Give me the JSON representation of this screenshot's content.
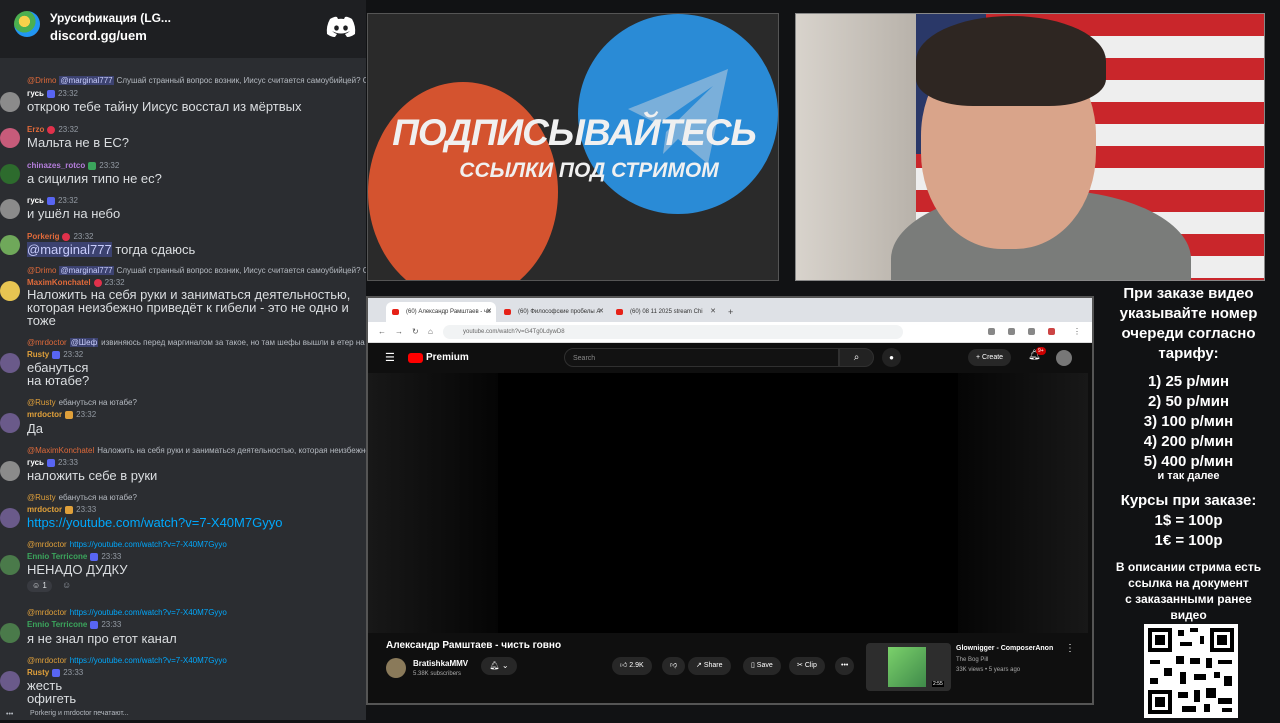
{
  "chat": {
    "server_name": "Урусификация (LG...",
    "server_invite": "discord.gg/uem",
    "typing": "Porkerig и mrdoctor печатают...",
    "messages": [
      {
        "reply_name": "@Drimo",
        "reply_mention": "@marginal777",
        "reply_text": "Слушай странный вопрос возник, Иисус считается самоубийцей?  Он вед",
        "user": "гусь",
        "user_color": "#ffffff",
        "time": "23:32",
        "text": "открою тебе тайну Иисус восстал из мёртвых"
      },
      {
        "user": "Erzo",
        "user_color": "#e06a3a",
        "time": "23:32",
        "text": "Мальта не в ЕС?"
      },
      {
        "user": "chinazes_rotco",
        "user_color": "#b57edc",
        "time": "23:32",
        "text": "а сицилия типо не ес?"
      },
      {
        "user": "гусь",
        "user_color": "#ffffff",
        "time": "23:32",
        "text": "и ушёл на небо"
      },
      {
        "user": "Porkerig",
        "user_color": "#e06a3a",
        "time": "23:32",
        "text_mention": "@marginal777",
        "text": " тогда сдаюсь"
      },
      {
        "reply_name": "@Drimo",
        "reply_mention": "@marginal777",
        "reply_text": "Слушай странный вопрос возник, Иисус считается самоубийцей?  Он вед",
        "user": "MaximKonchatel",
        "user_color": "#e06a3a",
        "time": "23:32",
        "text": "Наложить на себя руки и заниматься деятельностью, которая неизбежно приведёт  к гибели - это не одно и тоже"
      },
      {
        "reply_name": "@mrdoctor",
        "reply_mention": "@Шеф",
        "reply_text": "извиняюсь перед маргиналом за такое, но там шефы вышли в етер на канал .",
        "user": "Rusty",
        "user_color": "#e0a03a",
        "time": "23:32",
        "text": "ебануться на ютабе?"
      },
      {
        "reply_name": "@Rusty",
        "reply_text": "ебануться на ютабе?",
        "user": "mrdoctor",
        "user_color": "#e0a03a",
        "time": "23:32",
        "text": "Да"
      },
      {
        "reply_name": "@MaximKonchatel",
        "reply_text": "Наложить на себя руки и заниматься деятельностью, которая неизбежно при",
        "user": "гусь",
        "user_color": "#ffffff",
        "time": "23:33",
        "text": "наложить себе в руки"
      },
      {
        "reply_name": "@Rusty",
        "reply_text": "ебануться на ютабе?",
        "user": "mrdoctor",
        "user_color": "#e0a03a",
        "time": "23:33",
        "text": "https://youtube.com/watch?v=7-X40M7Gyyo",
        "is_link": true
      },
      {
        "reply_name": "@mrdoctor",
        "reply_text": "https://youtube.com/watch?v=7-X40M7Gyyo",
        "user": "Ennio Terricone",
        "user_color": "#3ba55c",
        "time": "23:33",
        "text": "НЕНАДО ДУДКУ",
        "reaction": "1"
      },
      {
        "reply_name": "@mrdoctor",
        "reply_text": "https://youtube.com/watch?v=7-X40M7Gyyo",
        "user": "Ennio Terricone",
        "user_color": "#3ba55c",
        "time": "23:33",
        "text": "я не знал про етот канал"
      },
      {
        "reply_name": "@mrdoctor",
        "reply_text": "https://youtube.com/watch?v=7-X40M7Gyyo",
        "user": "Rusty",
        "user_color": "#e0a03a",
        "time": "23:33",
        "text": "жесть офигеть"
      }
    ]
  },
  "banner": {
    "title": "ПОДПИСЫВАЙТЕСЬ",
    "subtitle": "ССЫЛКИ ПОД СТРИМОМ"
  },
  "browser": {
    "tabs": [
      {
        "label": "(60) Александр Рамштаев - чи"
      },
      {
        "label": "(60) Философские пробелы А"
      },
      {
        "label": "(60) 08 11 2025 stream Chi"
      }
    ],
    "url": "youtube.com/watch?v=G4Tg0LdywD8",
    "youtube": {
      "logo": "Premium",
      "search_placeholder": "Search",
      "create_label": "Create",
      "notifications": "9+",
      "video_title": "Александр Рамштаев - чисть говно",
      "channel_name": "BratishkaMMV",
      "channel_subs": "5.38K subscribers",
      "likes": "2.9K",
      "share": "Share",
      "save": "Save",
      "clip": "Clip",
      "more": "•••",
      "rec_title": "Glownigger - ComposerAnon",
      "rec_channel": "The Bog Pill",
      "rec_meta": "33K views • 5 years ago",
      "rec_duration": "2:55"
    }
  },
  "info": {
    "order_lines": [
      "При заказе видео",
      "указывайте номер",
      "очереди согласно",
      "тарифу:"
    ],
    "prices": [
      "1) 25 р/мин",
      "2) 50 р/мин",
      "3) 100 р/мин",
      "4) 200 р/мин",
      "5) 400 р/мин"
    ],
    "etc": "и так далее",
    "rates_title": "Курсы при заказе:",
    "rates": [
      "1$ = 100р",
      "1€ = 100р"
    ],
    "desc_lines": [
      "В описании стрима есть",
      "ссылка на документ",
      "с заказанными ранее",
      "видео"
    ]
  }
}
